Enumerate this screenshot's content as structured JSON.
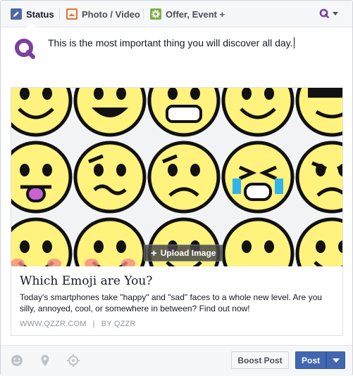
{
  "tabs": [
    {
      "label": "Status",
      "icon": "pencil-icon",
      "active": true
    },
    {
      "label": "Photo / Video",
      "icon": "photo-icon",
      "active": false
    },
    {
      "label": "Offer, Event +",
      "icon": "gear-icon",
      "active": false
    }
  ],
  "composer": {
    "text": "This is the most important thing you will discover all day."
  },
  "preview": {
    "upload_label": "Upload Image",
    "title": "Which Emoji are You?",
    "description": "Today's smartphones take \"happy\" and \"sad\" faces to a whole new level. Are you silly, annoyed, cool, or somewhere in between? Find out now!",
    "domain": "WWW.QZZR.COM",
    "separator": "|",
    "byline": "BY QZZR"
  },
  "footer": {
    "boost_label": "Boost Post",
    "post_label": "Post",
    "icons": [
      "emoji-icon",
      "location-pin-icon",
      "target-icon"
    ]
  },
  "colors": {
    "brand_purple": "#7b3fa0",
    "post_blue": "#4267b2",
    "emoji_yellow": "#fff27d"
  }
}
